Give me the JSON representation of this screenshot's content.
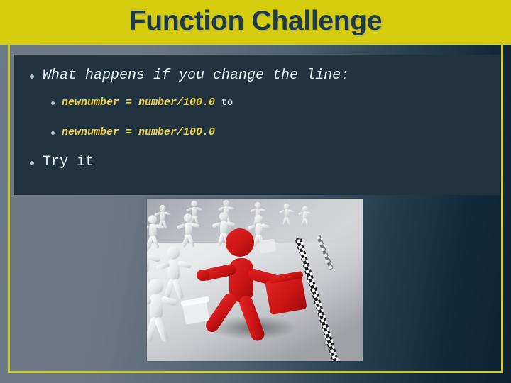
{
  "slide": {
    "title": "Function Challenge",
    "theme": {
      "title_band": "#d6cd0f",
      "title_text": "#1d3a4c",
      "panel": "#20333f",
      "rail": "#cfc828",
      "body_text": "#e9f2f2",
      "code_text": "#f0d24a",
      "bg_left": "#6b7885",
      "bg_right": "#0e2433",
      "figure_accent": "#cc1d1d"
    },
    "bullets": [
      {
        "level": 1,
        "text": "What happens if you change the line:",
        "style": "italic",
        "color": "#e9f2f2"
      },
      {
        "level": 2,
        "text": "newnumber = number/100.0",
        "trailing": "to",
        "style": "italic-bold",
        "color": "#f0d24a"
      },
      {
        "level": 2,
        "text": "newnumber = number/100.0",
        "trailing": "",
        "style": "italic-bold",
        "color": "#f0d24a"
      },
      {
        "level": 1,
        "text": "Try it",
        "style": "plain",
        "color": "#e9f2f2"
      }
    ],
    "image": {
      "name": "red-figure-leading-crowd",
      "alt": "A red 3D stick figure carrying a briefcase runs ahead of a crowd of white figures toward a checkered finish line"
    }
  }
}
